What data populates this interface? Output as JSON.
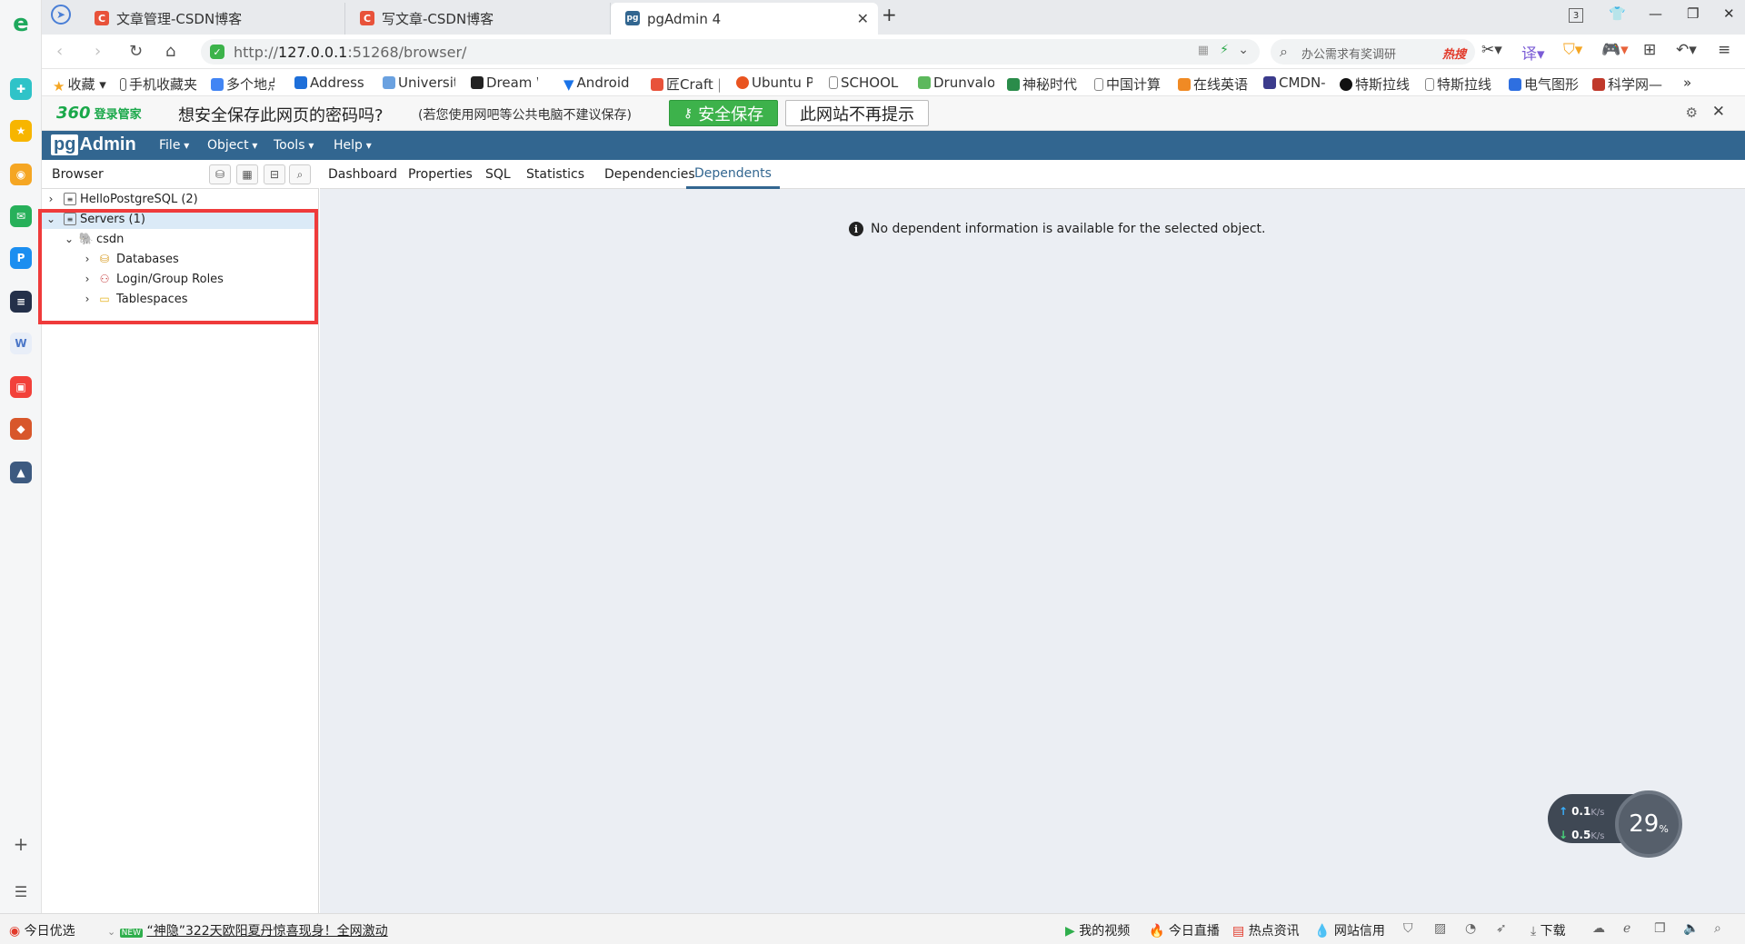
{
  "browser": {
    "tabs": [
      {
        "title": "文章管理-CSDN博客",
        "favicon": "C",
        "active": false
      },
      {
        "title": "写文章-CSDN博客",
        "favicon": "C",
        "active": false
      },
      {
        "title": "pgAdmin 4",
        "favicon": "pg",
        "active": true
      }
    ],
    "tab_count_badge": "3",
    "address": {
      "prefix": "http://",
      "host": "127.0.0.1",
      "rest": ":51268/browser/"
    },
    "search": {
      "placeholder": "办公需求有奖调研",
      "hot_label": "热搜"
    },
    "bookmarks": [
      "收藏",
      "手机收藏夹",
      "多个地点",
      "Address",
      "Universit",
      "Dream W",
      "Android",
      "匠Craft |",
      "Ubuntu P",
      "SCHOOL",
      "Drunvalo",
      "神秘时代",
      "中国计算",
      "在线英语",
      "CMDN-",
      "特斯拉线",
      "特斯拉线",
      "电气图形",
      "科学网—"
    ],
    "bookmarks_more": "»"
  },
  "password_bar": {
    "brand": "360",
    "brand_sub": "登录管家",
    "question": "想安全保存此网页的密码吗?",
    "hint": "(若您使用网吧等公共电脑不建议保存)",
    "save_label": "安全保存",
    "no_more_label": "此网站不再提示"
  },
  "pgadmin": {
    "logo_pg": "pg",
    "logo_rest": "Admin",
    "menus": [
      "File",
      "Object",
      "Tools",
      "Help"
    ],
    "browser_title": "Browser",
    "tree": [
      {
        "label": "HelloPostgreSQL (2)",
        "level": 0,
        "expanded": false,
        "icon": "server-group-icon",
        "selected": false
      },
      {
        "label": "Servers (1)",
        "level": 0,
        "expanded": true,
        "icon": "server-group-icon",
        "selected": true
      },
      {
        "label": "csdn",
        "level": 1,
        "expanded": true,
        "icon": "postgres-elephant-icon",
        "selected": false
      },
      {
        "label": "Databases",
        "level": 2,
        "expanded": false,
        "icon": "database-icon",
        "selected": false
      },
      {
        "label": "Login/Group Roles",
        "level": 2,
        "expanded": false,
        "icon": "roles-icon",
        "selected": false
      },
      {
        "label": "Tablespaces",
        "level": 2,
        "expanded": false,
        "icon": "folder-icon",
        "selected": false
      }
    ],
    "main_tabs": [
      "Dashboard",
      "Properties",
      "SQL",
      "Statistics",
      "Dependencies",
      "Dependents"
    ],
    "active_tab": "Dependents",
    "message": "No dependent information is available for the selected object."
  },
  "network_widget": {
    "up_value": "0.1",
    "down_value": "0.5",
    "unit": "K/s",
    "percent": "29",
    "percent_sign": "%"
  },
  "statusbar": {
    "left_label": "今日优选",
    "news_badge": "NEW",
    "news": "“神隐”322天欧阳夏丹惊喜现身！全网激动",
    "items": [
      "我的视频",
      "今日直播",
      "热点资讯",
      "网站信用",
      "下载"
    ]
  },
  "colors": {
    "pgadmin_header": "#326690",
    "selection": "#dbeaf7",
    "highlight_box": "#ef3b3b",
    "save_green": "#3db24b",
    "content_bg": "#ebeef3"
  }
}
